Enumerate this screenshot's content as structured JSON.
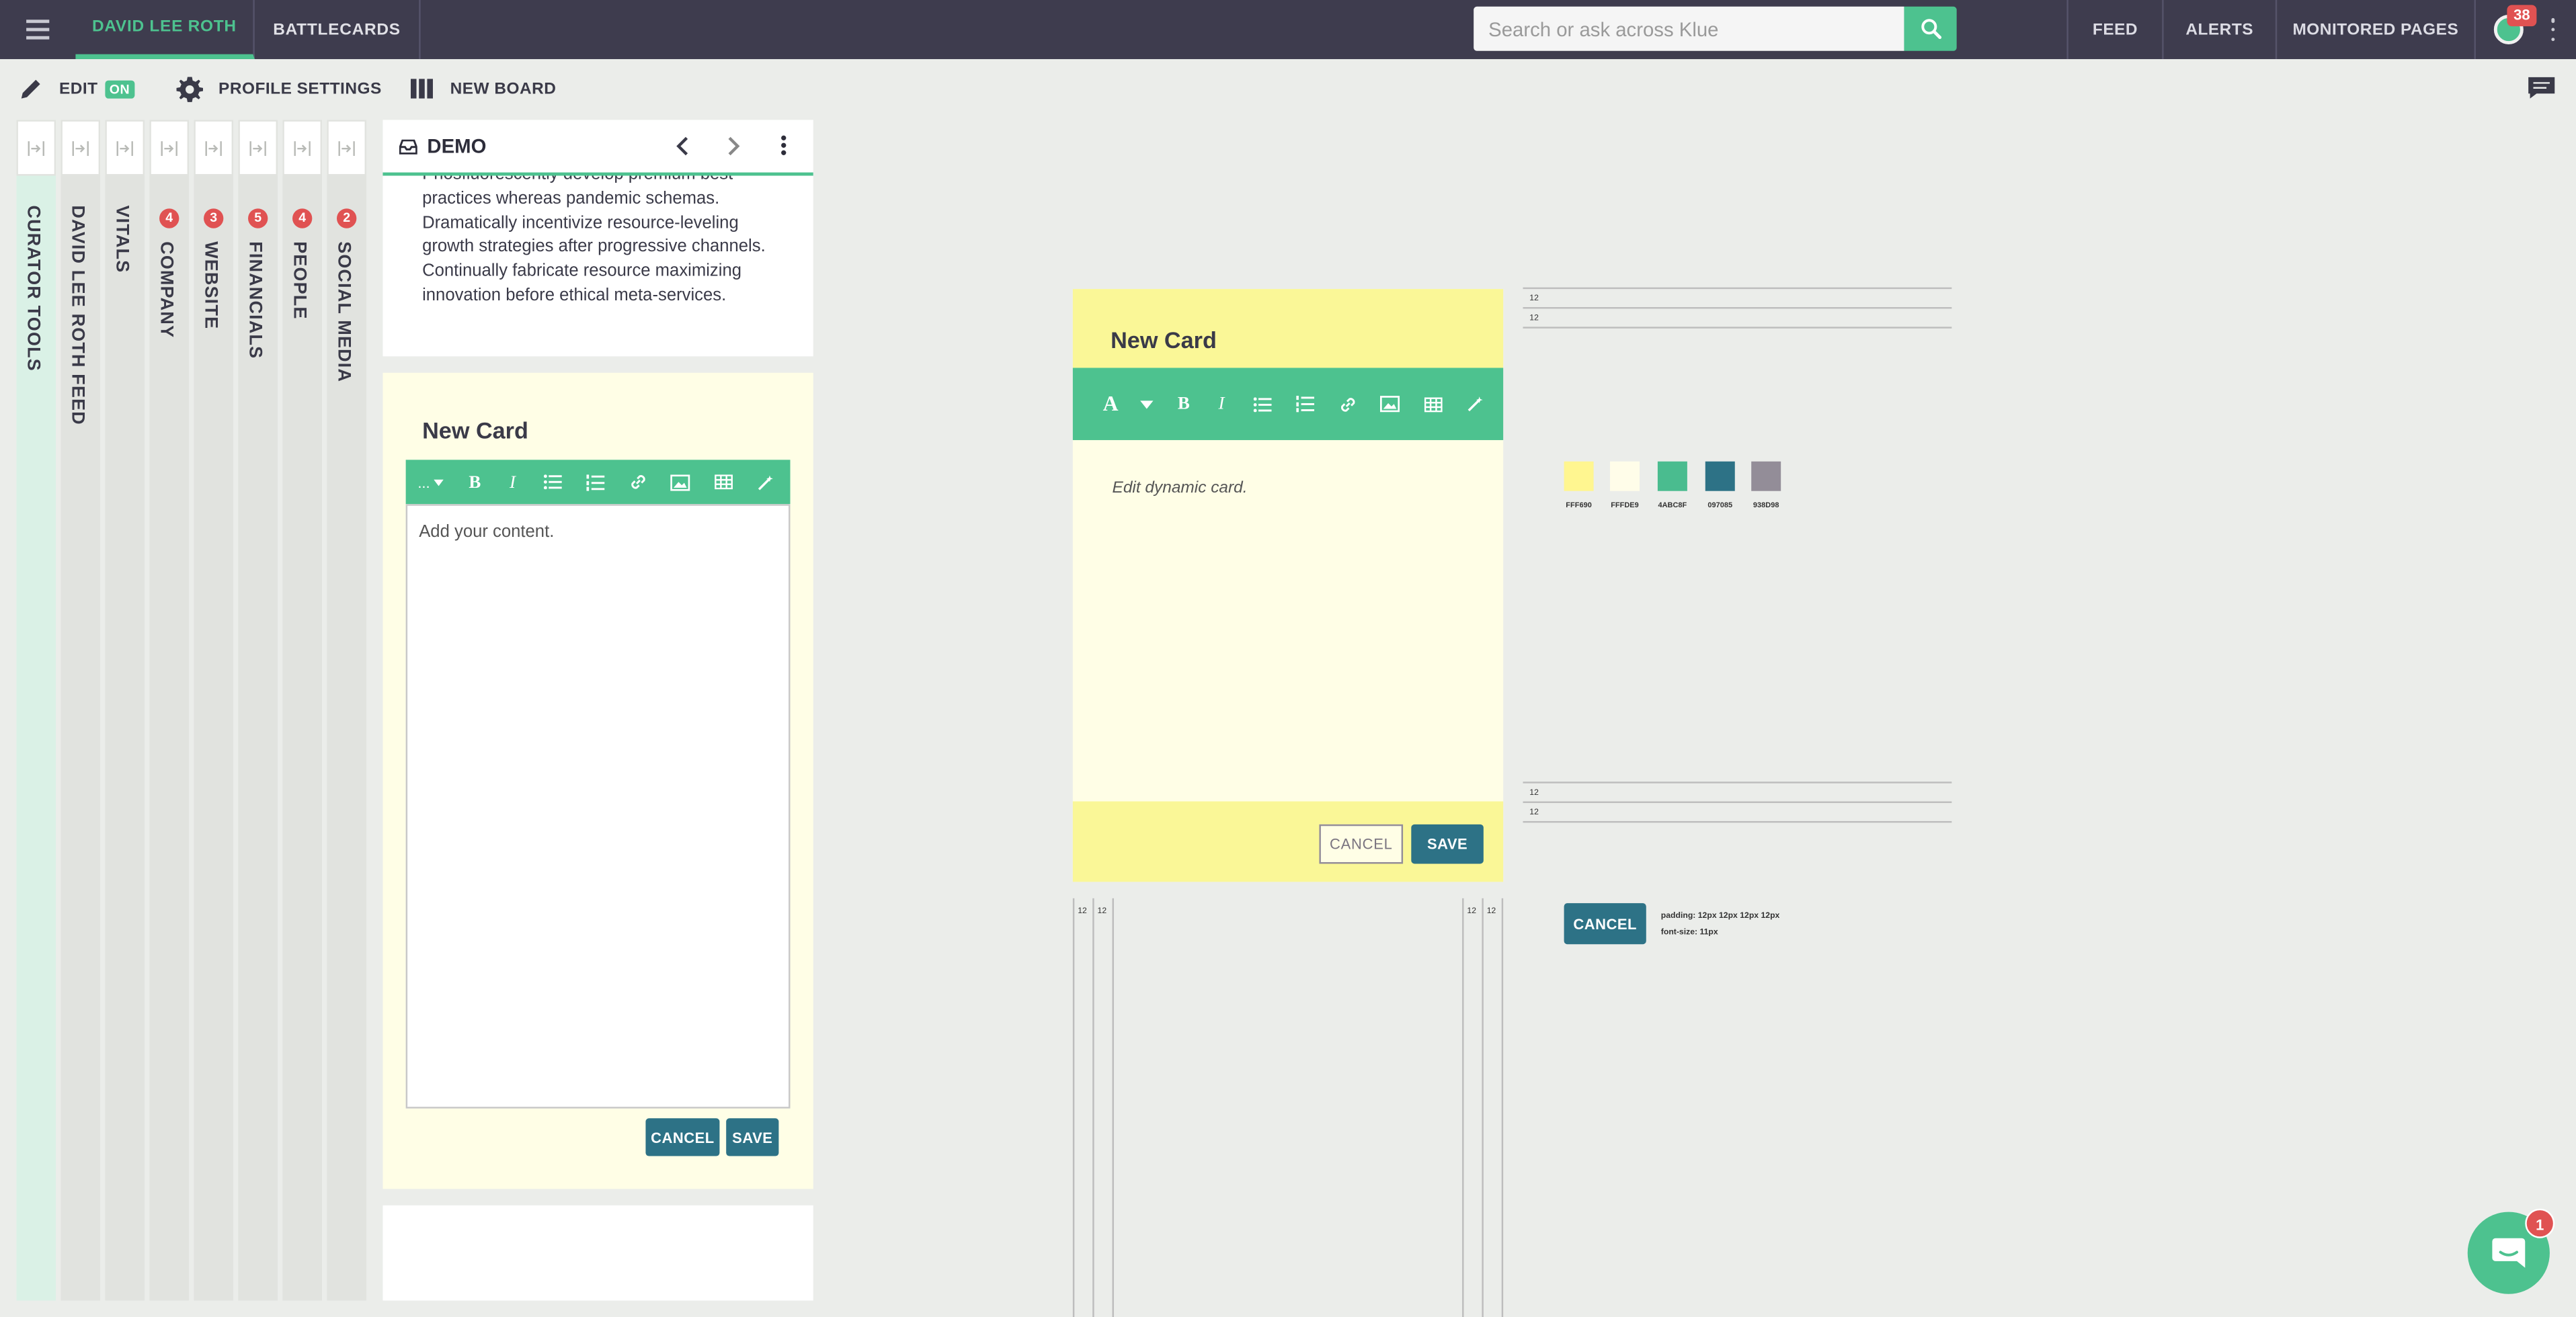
{
  "topbar": {
    "tabs": [
      {
        "label": "DAVID LEE ROTH",
        "active": true
      },
      {
        "label": "BATTLECARDS",
        "active": false
      }
    ],
    "search_placeholder": "Search or ask across Klue",
    "links": [
      "FEED",
      "ALERTS",
      "MONITORED PAGES"
    ],
    "notification_count": "38"
  },
  "toolbar": {
    "edit_label": "EDIT",
    "edit_state": "ON",
    "profile_settings_label": "PROFILE SETTINGS",
    "new_board_label": "NEW BOARD"
  },
  "lanes": [
    {
      "label": "CURATOR TOOLS",
      "badge": ""
    },
    {
      "label": "DAVID LEE ROTH FEED",
      "badge": ""
    },
    {
      "label": "VITALS",
      "badge": ""
    },
    {
      "label": "COMPANY",
      "badge": "4"
    },
    {
      "label": "WEBSITE",
      "badge": "3"
    },
    {
      "label": "FINANCIALS",
      "badge": "5"
    },
    {
      "label": "PEOPLE",
      "badge": "4"
    },
    {
      "label": "SOCIAL MEDIA",
      "badge": "2"
    }
  ],
  "board": {
    "title": "DEMO",
    "card_text": "Phosfluorescently develop premium best practices whereas pandemic schemas. Dramatically incentivize resource-leveling growth strategies after progressive channels. Continually fabricate resource maximizing innovation before ethical meta-services."
  },
  "new_card_editor": {
    "title": "New Card",
    "format_label": "...",
    "content_placeholder": "Add your content.",
    "cancel_label": "CANCEL",
    "save_label": "SAVE"
  },
  "spec_card": {
    "title": "New Card",
    "placeholder": "Edit dynamic card.",
    "cancel_label": "CANCEL",
    "save_label": "SAVE"
  },
  "spec": {
    "spacing_value": "12",
    "swatches": [
      {
        "label": "FFF690",
        "color": "#fff690"
      },
      {
        "label": "FFFDE9",
        "color": "#fffde9"
      },
      {
        "label": "4ABC8F",
        "color": "#4abc8f"
      },
      {
        "label": "097085",
        "color": "#2d7286"
      },
      {
        "label": "938D98",
        "color": "#938d98"
      }
    ],
    "cancel_button_label": "CANCEL",
    "padding_note": "padding: 12px 12px 12px 12px",
    "font_note": "font-size: 11px"
  },
  "help": {
    "badge": "1"
  },
  "colors": {
    "topbar": "#3e3c4e",
    "accent_green": "#4dc28f",
    "button_teal": "#2d7286",
    "card_yellow": "#faf797",
    "card_cream": "#fffee6"
  }
}
